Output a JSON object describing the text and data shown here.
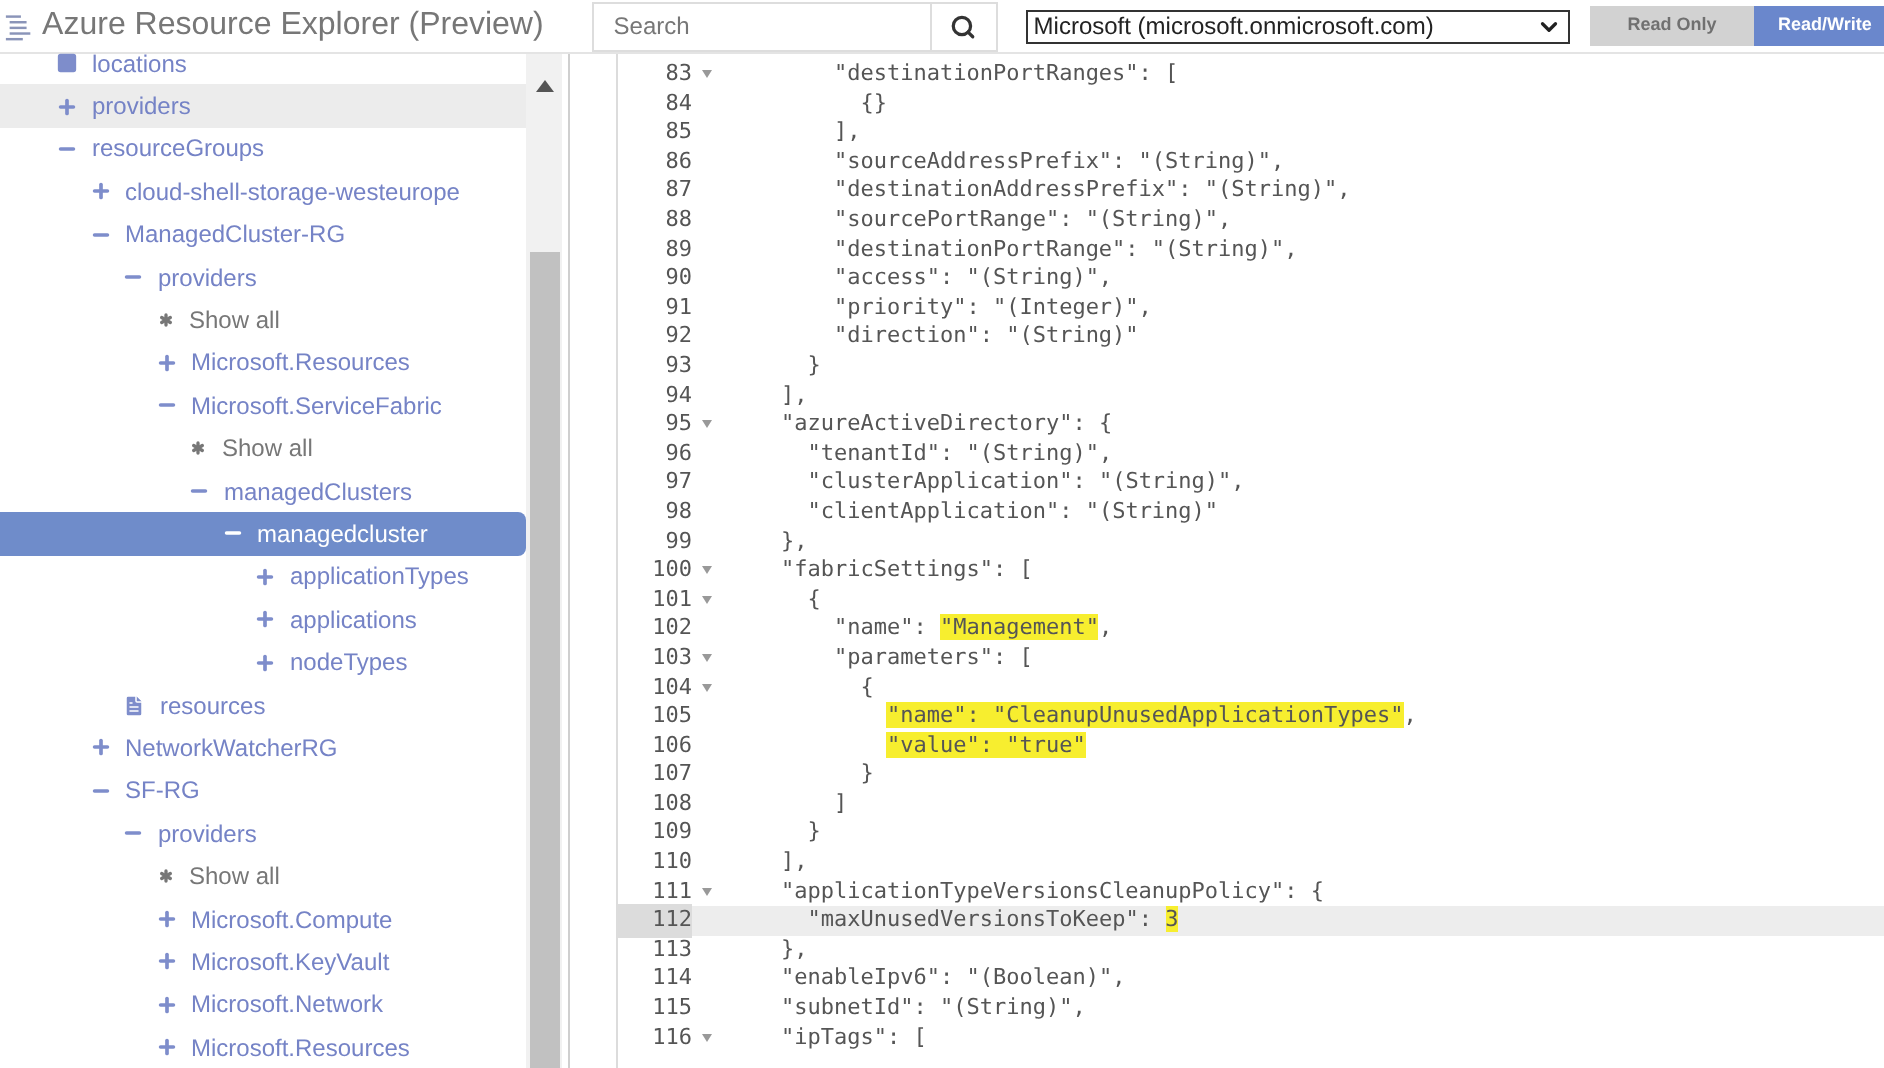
{
  "header": {
    "title": "Azure Resource Explorer (Preview)",
    "search": {
      "placeholder": "Search"
    },
    "directory": {
      "value": "Microsoft (microsoft.onmicrosoft.com)"
    },
    "modes": [
      {
        "label": "Read Only",
        "selected": false
      },
      {
        "label": "Read/Write",
        "selected": true
      }
    ]
  },
  "tree": [
    {
      "kind": "folder",
      "label": "locations",
      "selected": false,
      "hovered": false
    },
    {
      "kind": "node",
      "label": "providers",
      "expanded": false,
      "selected": false,
      "hovered": true
    },
    {
      "kind": "node",
      "label": "resourceGroups",
      "expanded": true,
      "selected": false,
      "hovered": false,
      "children": [
        {
          "kind": "node",
          "label": "cloud-shell-storage-westeurope",
          "expanded": false,
          "selected": false,
          "hovered": false
        },
        {
          "kind": "node",
          "label": "ManagedCluster-RG",
          "expanded": true,
          "selected": false,
          "hovered": false,
          "children": [
            {
              "kind": "node",
              "label": "providers",
              "expanded": true,
              "selected": false,
              "hovered": false,
              "children": [
                {
                  "kind": "showall",
                  "label": "Show all",
                  "selected": false,
                  "hovered": false
                },
                {
                  "kind": "node",
                  "label": "Microsoft.Resources",
                  "expanded": false,
                  "selected": false,
                  "hovered": false
                },
                {
                  "kind": "node",
                  "label": "Microsoft.ServiceFabric",
                  "expanded": true,
                  "selected": false,
                  "hovered": false,
                  "children": [
                    {
                      "kind": "showall",
                      "label": "Show all",
                      "selected": false,
                      "hovered": false
                    },
                    {
                      "kind": "node",
                      "label": "managedClusters",
                      "expanded": true,
                      "selected": false,
                      "hovered": false,
                      "children": [
                        {
                          "kind": "node",
                          "label": "managedcluster",
                          "expanded": true,
                          "selected": true,
                          "hovered": false,
                          "children": [
                            {
                              "kind": "node",
                              "label": "applicationTypes",
                              "expanded": false,
                              "selected": false,
                              "hovered": false
                            },
                            {
                              "kind": "node",
                              "label": "applications",
                              "expanded": false,
                              "selected": false,
                              "hovered": false
                            },
                            {
                              "kind": "node",
                              "label": "nodeTypes",
                              "expanded": false,
                              "selected": false,
                              "hovered": false
                            }
                          ]
                        }
                      ]
                    }
                  ]
                }
              ]
            },
            {
              "kind": "document",
              "label": "resources",
              "selected": false,
              "hovered": false
            }
          ]
        },
        {
          "kind": "node",
          "label": "NetworkWatcherRG",
          "expanded": false,
          "selected": false,
          "hovered": false
        },
        {
          "kind": "node",
          "label": "SF-RG",
          "expanded": true,
          "selected": false,
          "hovered": false,
          "children": [
            {
              "kind": "node",
              "label": "providers",
              "expanded": true,
              "selected": false,
              "hovered": false,
              "children": [
                {
                  "kind": "showall",
                  "label": "Show all",
                  "selected": false,
                  "hovered": false
                },
                {
                  "kind": "node",
                  "label": "Microsoft.Compute",
                  "expanded": false,
                  "selected": false,
                  "hovered": false
                },
                {
                  "kind": "node",
                  "label": "Microsoft.KeyVault",
                  "expanded": false,
                  "selected": false,
                  "hovered": false
                },
                {
                  "kind": "node",
                  "label": "Microsoft.Network",
                  "expanded": false,
                  "selected": false,
                  "hovered": false
                },
                {
                  "kind": "node",
                  "label": "Microsoft.Resources",
                  "expanded": false,
                  "selected": false,
                  "hovered": false
                }
              ]
            }
          ]
        }
      ]
    }
  ],
  "editor": {
    "lines": [
      {
        "number": "83",
        "foldable": true,
        "active": false,
        "segments": [
          {
            "text": "        \"destinationPortRanges\": [",
            "highlight": false
          }
        ]
      },
      {
        "number": "84",
        "foldable": false,
        "active": false,
        "segments": [
          {
            "text": "          {}",
            "highlight": false
          }
        ]
      },
      {
        "number": "85",
        "foldable": false,
        "active": false,
        "segments": [
          {
            "text": "        ],",
            "highlight": false
          }
        ]
      },
      {
        "number": "86",
        "foldable": false,
        "active": false,
        "segments": [
          {
            "text": "        \"sourceAddressPrefix\": \"(String)\",",
            "highlight": false
          }
        ]
      },
      {
        "number": "87",
        "foldable": false,
        "active": false,
        "segments": [
          {
            "text": "        \"destinationAddressPrefix\": \"(String)\",",
            "highlight": false
          }
        ]
      },
      {
        "number": "88",
        "foldable": false,
        "active": false,
        "segments": [
          {
            "text": "        \"sourcePortRange\": \"(String)\",",
            "highlight": false
          }
        ]
      },
      {
        "number": "89",
        "foldable": false,
        "active": false,
        "segments": [
          {
            "text": "        \"destinationPortRange\": \"(String)\",",
            "highlight": false
          }
        ]
      },
      {
        "number": "90",
        "foldable": false,
        "active": false,
        "segments": [
          {
            "text": "        \"access\": \"(String)\",",
            "highlight": false
          }
        ]
      },
      {
        "number": "91",
        "foldable": false,
        "active": false,
        "segments": [
          {
            "text": "        \"priority\": \"(Integer)\",",
            "highlight": false
          }
        ]
      },
      {
        "number": "92",
        "foldable": false,
        "active": false,
        "segments": [
          {
            "text": "        \"direction\": \"(String)\"",
            "highlight": false
          }
        ]
      },
      {
        "number": "93",
        "foldable": false,
        "active": false,
        "segments": [
          {
            "text": "      }",
            "highlight": false
          }
        ]
      },
      {
        "number": "94",
        "foldable": false,
        "active": false,
        "segments": [
          {
            "text": "    ],",
            "highlight": false
          }
        ]
      },
      {
        "number": "95",
        "foldable": true,
        "active": false,
        "segments": [
          {
            "text": "    \"azureActiveDirectory\": {",
            "highlight": false
          }
        ]
      },
      {
        "number": "96",
        "foldable": false,
        "active": false,
        "segments": [
          {
            "text": "      \"tenantId\": \"(String)\",",
            "highlight": false
          }
        ]
      },
      {
        "number": "97",
        "foldable": false,
        "active": false,
        "segments": [
          {
            "text": "      \"clusterApplication\": \"(String)\",",
            "highlight": false
          }
        ]
      },
      {
        "number": "98",
        "foldable": false,
        "active": false,
        "segments": [
          {
            "text": "      \"clientApplication\": \"(String)\"",
            "highlight": false
          }
        ]
      },
      {
        "number": "99",
        "foldable": false,
        "active": false,
        "segments": [
          {
            "text": "    },",
            "highlight": false
          }
        ]
      },
      {
        "number": "100",
        "foldable": true,
        "active": false,
        "segments": [
          {
            "text": "    \"fabricSettings\": [",
            "highlight": false
          }
        ]
      },
      {
        "number": "101",
        "foldable": true,
        "active": false,
        "segments": [
          {
            "text": "      {",
            "highlight": false
          }
        ]
      },
      {
        "number": "102",
        "foldable": false,
        "active": false,
        "segments": [
          {
            "text": "        \"name\": ",
            "highlight": false
          },
          {
            "text": "\"Management\"",
            "highlight": true
          },
          {
            "text": ",",
            "highlight": false
          }
        ]
      },
      {
        "number": "103",
        "foldable": true,
        "active": false,
        "segments": [
          {
            "text": "        \"parameters\": [",
            "highlight": false
          }
        ]
      },
      {
        "number": "104",
        "foldable": true,
        "active": false,
        "segments": [
          {
            "text": "          {",
            "highlight": false
          }
        ]
      },
      {
        "number": "105",
        "foldable": false,
        "active": false,
        "segments": [
          {
            "text": "            \"name\": \"CleanupUnusedApplicationTypes\"",
            "highlight": true
          },
          {
            "text": ",",
            "highlight": false
          }
        ]
      },
      {
        "number": "106",
        "foldable": false,
        "active": false,
        "segments": [
          {
            "text": "            \"value\": \"true\"",
            "highlight": true
          }
        ]
      },
      {
        "number": "107",
        "foldable": false,
        "active": false,
        "segments": [
          {
            "text": "          }",
            "highlight": false
          }
        ]
      },
      {
        "number": "108",
        "foldable": false,
        "active": false,
        "segments": [
          {
            "text": "        ]",
            "highlight": false
          }
        ]
      },
      {
        "number": "109",
        "foldable": false,
        "active": false,
        "segments": [
          {
            "text": "      }",
            "highlight": false
          }
        ]
      },
      {
        "number": "110",
        "foldable": false,
        "active": false,
        "segments": [
          {
            "text": "    ],",
            "highlight": false
          }
        ]
      },
      {
        "number": "111",
        "foldable": true,
        "active": false,
        "segments": [
          {
            "text": "    \"applicationTypeVersionsCleanupPolicy\": {",
            "highlight": false
          }
        ]
      },
      {
        "number": "112",
        "foldable": false,
        "active": true,
        "segments": [
          {
            "text": "      \"maxUnusedVersionsToKeep\": ",
            "highlight": false
          },
          {
            "text": "3",
            "highlight": true
          }
        ]
      },
      {
        "number": "113",
        "foldable": false,
        "active": false,
        "segments": [
          {
            "text": "    },",
            "highlight": false
          }
        ]
      },
      {
        "number": "114",
        "foldable": false,
        "active": false,
        "segments": [
          {
            "text": "    \"enableIpv6\": \"(Boolean)\",",
            "highlight": false
          }
        ]
      },
      {
        "number": "115",
        "foldable": false,
        "active": false,
        "segments": [
          {
            "text": "    \"subnetId\": \"(String)\",",
            "highlight": false
          }
        ]
      },
      {
        "number": "116",
        "foldable": true,
        "active": false,
        "segments": [
          {
            "text": "    \"ipTags\": [",
            "highlight": false
          }
        ]
      }
    ]
  }
}
